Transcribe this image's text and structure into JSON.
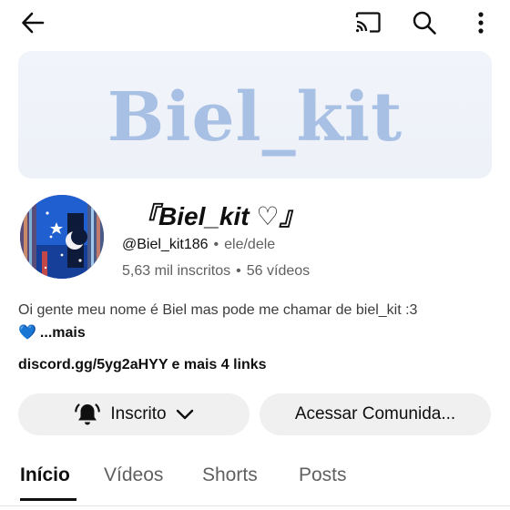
{
  "topbar": {
    "back_icon": "arrow-left-icon",
    "cast_icon": "cast-icon",
    "search_icon": "search-icon",
    "more_icon": "more-vertical-icon"
  },
  "banner": {
    "text": "Biel_kit"
  },
  "channel": {
    "name": "『Biel_kit ♡』",
    "handle": "@Biel_kit186",
    "pronouns": "ele/dele",
    "subscribers": "5,63 mil inscritos",
    "videos": "56 vídeos",
    "description": "Oi gente meu nome é Biel mas pode me chamar de biel_kit :3",
    "description_emoji": "💙",
    "more_label": "...mais",
    "link_main": "discord.gg/5yg2aHYY",
    "link_extra": "e mais 4 links"
  },
  "actions": {
    "subscribed_label": "Inscrito",
    "community_label": "Acessar Comunida..."
  },
  "tabs": [
    {
      "label": "Início",
      "active": true
    },
    {
      "label": "Vídeos",
      "active": false
    },
    {
      "label": "Shorts",
      "active": false
    },
    {
      "label": "Posts",
      "active": false
    }
  ],
  "colors": {
    "banner_text": "#a8c0e4",
    "banner_bg": "#eef2f9",
    "button_bg": "#f0f0f0",
    "secondary_text": "#606060"
  }
}
